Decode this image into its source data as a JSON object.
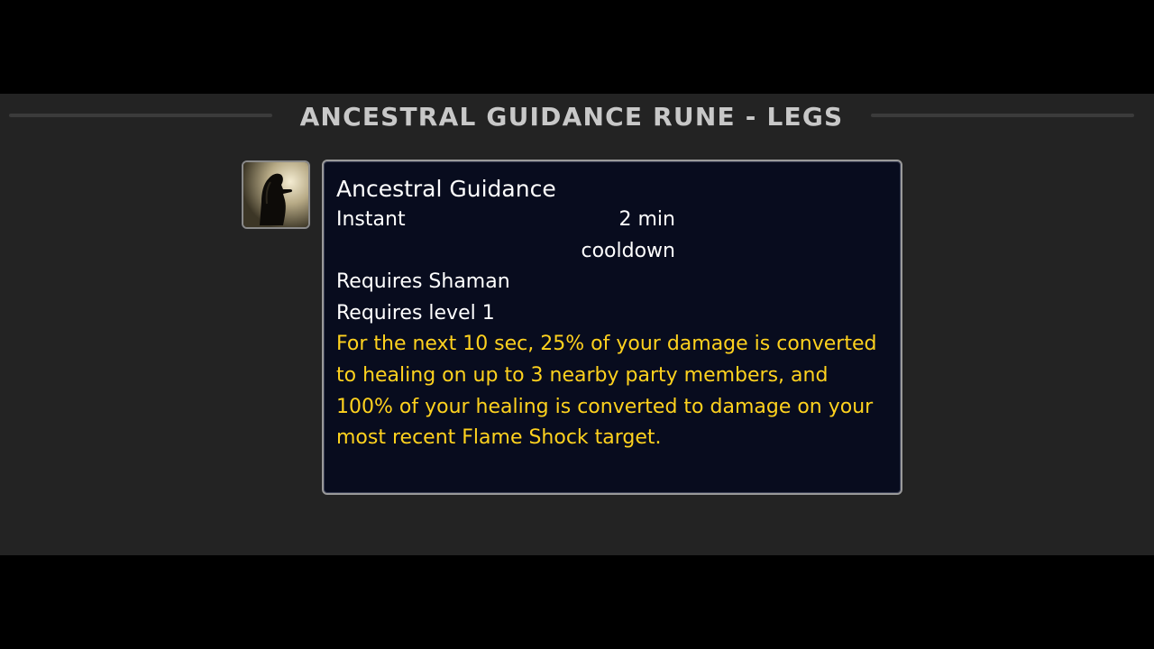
{
  "heading": "ANCESTRAL GUIDANCE RUNE - LEGS",
  "icon": {
    "name": "ancestral-guidance-icon"
  },
  "tooltip": {
    "spell_name": "Ancestral Guidance",
    "cast_time": "Instant",
    "cooldown_line1": "2 min",
    "cooldown_line2": "cooldown",
    "requires_class": "Requires Shaman",
    "requires_level": "Requires level 1",
    "description": "For the next 10 sec, 25% of your damage is converted to healing on up to 3 nearby party members, and 100% of your healing is converted to damage on your most recent Flame Shock target."
  },
  "colors": {
    "background": "#232323",
    "letterbox": "#000000",
    "heading": "#c8c8c8",
    "tooltip_bg": "#080c1e",
    "tooltip_text": "#ffffff",
    "tooltip_description": "#ffd21e"
  }
}
